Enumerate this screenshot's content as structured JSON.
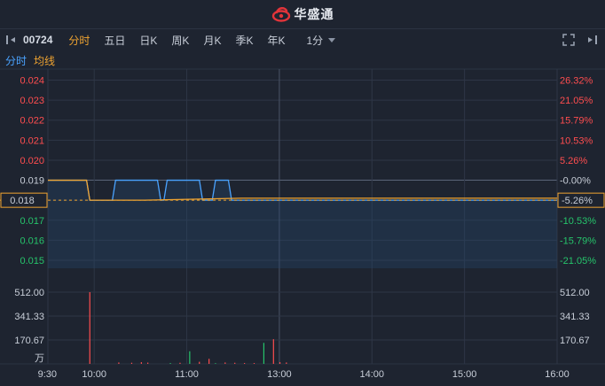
{
  "app": {
    "brand_name": "华盛通"
  },
  "toolbar": {
    "stock_code": "00724",
    "tabs": [
      {
        "label": "分时",
        "active": true
      },
      {
        "label": "五日",
        "active": false
      },
      {
        "label": "日K",
        "active": false
      },
      {
        "label": "周K",
        "active": false
      },
      {
        "label": "月K",
        "active": false
      },
      {
        "label": "季K",
        "active": false
      },
      {
        "label": "年K",
        "active": false
      }
    ],
    "interval": "1分"
  },
  "legend": {
    "timeshare": "分时",
    "avg_line": "均线"
  },
  "colors": {
    "up": "#ff4d4f",
    "down": "#26c46b",
    "price": "#4aa3ff",
    "avg": "#f0a431",
    "grid": "#2e3646"
  },
  "chart_data": {
    "type": "line",
    "price_labels": [
      "0.024",
      "0.023",
      "0.022",
      "0.021",
      "0.020",
      "0.019",
      "0.018",
      "0.017",
      "0.016",
      "0.015"
    ],
    "pct_labels": [
      "26.32%",
      "21.05%",
      "15.79%",
      "10.53%",
      "5.26%",
      "-0.00%",
      "-5.26%",
      "-10.53%",
      "-15.79%",
      "-21.05%"
    ],
    "current_price": "0.018",
    "current_pct": "-5.26%",
    "prev_close": 0.019,
    "ylim": [
      0.0146,
      0.0242
    ],
    "price_series": [
      [
        0.0,
        0.019
      ],
      [
        0.12,
        0.019
      ],
      [
        0.13,
        0.018
      ],
      [
        0.2,
        0.018
      ],
      [
        0.21,
        0.019
      ],
      [
        0.34,
        0.019
      ],
      [
        0.35,
        0.018
      ],
      [
        0.36,
        0.018
      ],
      [
        0.37,
        0.019
      ],
      [
        0.47,
        0.019
      ],
      [
        0.48,
        0.018
      ],
      [
        0.51,
        0.018
      ],
      [
        0.52,
        0.019
      ],
      [
        0.56,
        0.019
      ],
      [
        0.57,
        0.018
      ],
      [
        1.1,
        0.018
      ],
      [
        1.58,
        0.018
      ]
    ],
    "avg_series": [
      [
        0.0,
        0.019
      ],
      [
        0.12,
        0.019
      ],
      [
        0.13,
        0.018
      ],
      [
        0.3,
        0.018
      ],
      [
        0.6,
        0.0181
      ],
      [
        1.58,
        0.0181
      ]
    ],
    "volume_labels": [
      "512.00",
      "341.33",
      "170.67"
    ],
    "volume_unit": "万",
    "volume_max": 512,
    "volume_bars": [
      {
        "t": 0.13,
        "v": 512,
        "dir": "up"
      },
      {
        "t": 0.22,
        "v": 10,
        "dir": "up"
      },
      {
        "t": 0.26,
        "v": 8,
        "dir": "up"
      },
      {
        "t": 0.29,
        "v": 12,
        "dir": "up"
      },
      {
        "t": 0.31,
        "v": 9,
        "dir": "up"
      },
      {
        "t": 0.38,
        "v": 6,
        "dir": "down"
      },
      {
        "t": 0.41,
        "v": 8,
        "dir": "up"
      },
      {
        "t": 0.44,
        "v": 90,
        "dir": "down"
      },
      {
        "t": 0.47,
        "v": 15,
        "dir": "up"
      },
      {
        "t": 0.5,
        "v": 36,
        "dir": "up"
      },
      {
        "t": 0.52,
        "v": 5,
        "dir": "down"
      },
      {
        "t": 0.55,
        "v": 10,
        "dir": "up"
      },
      {
        "t": 0.58,
        "v": 8,
        "dir": "up"
      },
      {
        "t": 0.61,
        "v": 6,
        "dir": "up"
      },
      {
        "t": 0.64,
        "v": 6,
        "dir": "up"
      },
      {
        "t": 0.67,
        "v": 150,
        "dir": "down"
      },
      {
        "t": 0.7,
        "v": 176,
        "dir": "up"
      },
      {
        "t": 0.72,
        "v": 12,
        "dir": "up"
      },
      {
        "t": 0.74,
        "v": 10,
        "dir": "up"
      }
    ],
    "time_labels": [
      "9:30",
      "10:00",
      "11:00",
      "13:00",
      "14:00",
      "15:00",
      "16:00"
    ]
  }
}
